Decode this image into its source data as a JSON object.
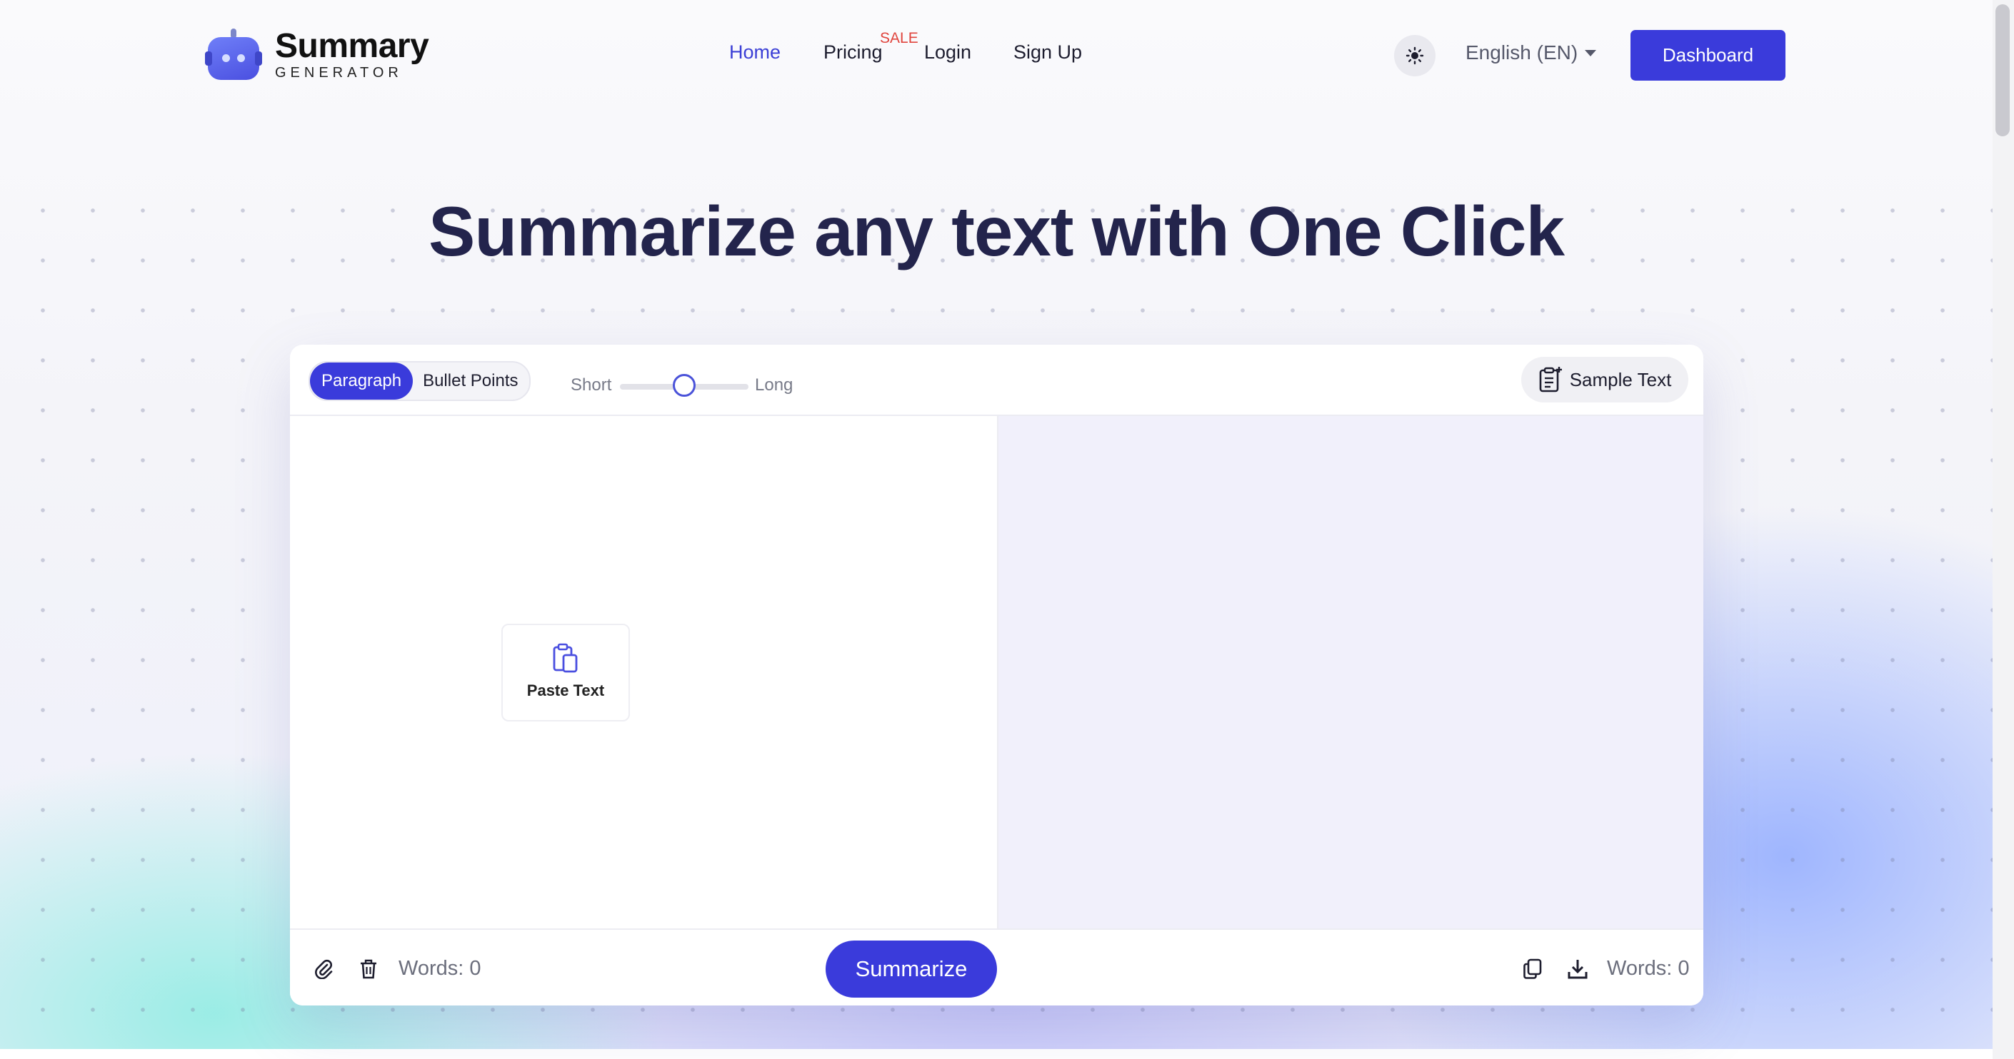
{
  "brand": {
    "name": "Summary",
    "tagline": "GENERATOR"
  },
  "nav": {
    "home": "Home",
    "pricing": "Pricing",
    "sale_badge": "SALE",
    "login": "Login",
    "signup": "Sign Up"
  },
  "header": {
    "theme_toggle_icon": "sun-icon",
    "language": "English (EN)",
    "dashboard_label": "Dashboard"
  },
  "hero": {
    "title": "Summarize any text with One Click"
  },
  "editor": {
    "modes": {
      "paragraph": "Paragraph",
      "bullets": "Bullet Points",
      "selected": "Paragraph"
    },
    "length": {
      "short_label": "Short",
      "long_label": "Long",
      "value_fraction": 0.5
    },
    "sample_label": "Sample Text",
    "paste_label": "Paste Text",
    "summarize_label": "Summarize",
    "input_words": "Words: 0",
    "output_words": "Words: 0"
  },
  "colors": {
    "accent": "#3a3bdb",
    "sale": "#e0443d",
    "heading": "#23244c",
    "output_bg": "#f1f0fb"
  }
}
